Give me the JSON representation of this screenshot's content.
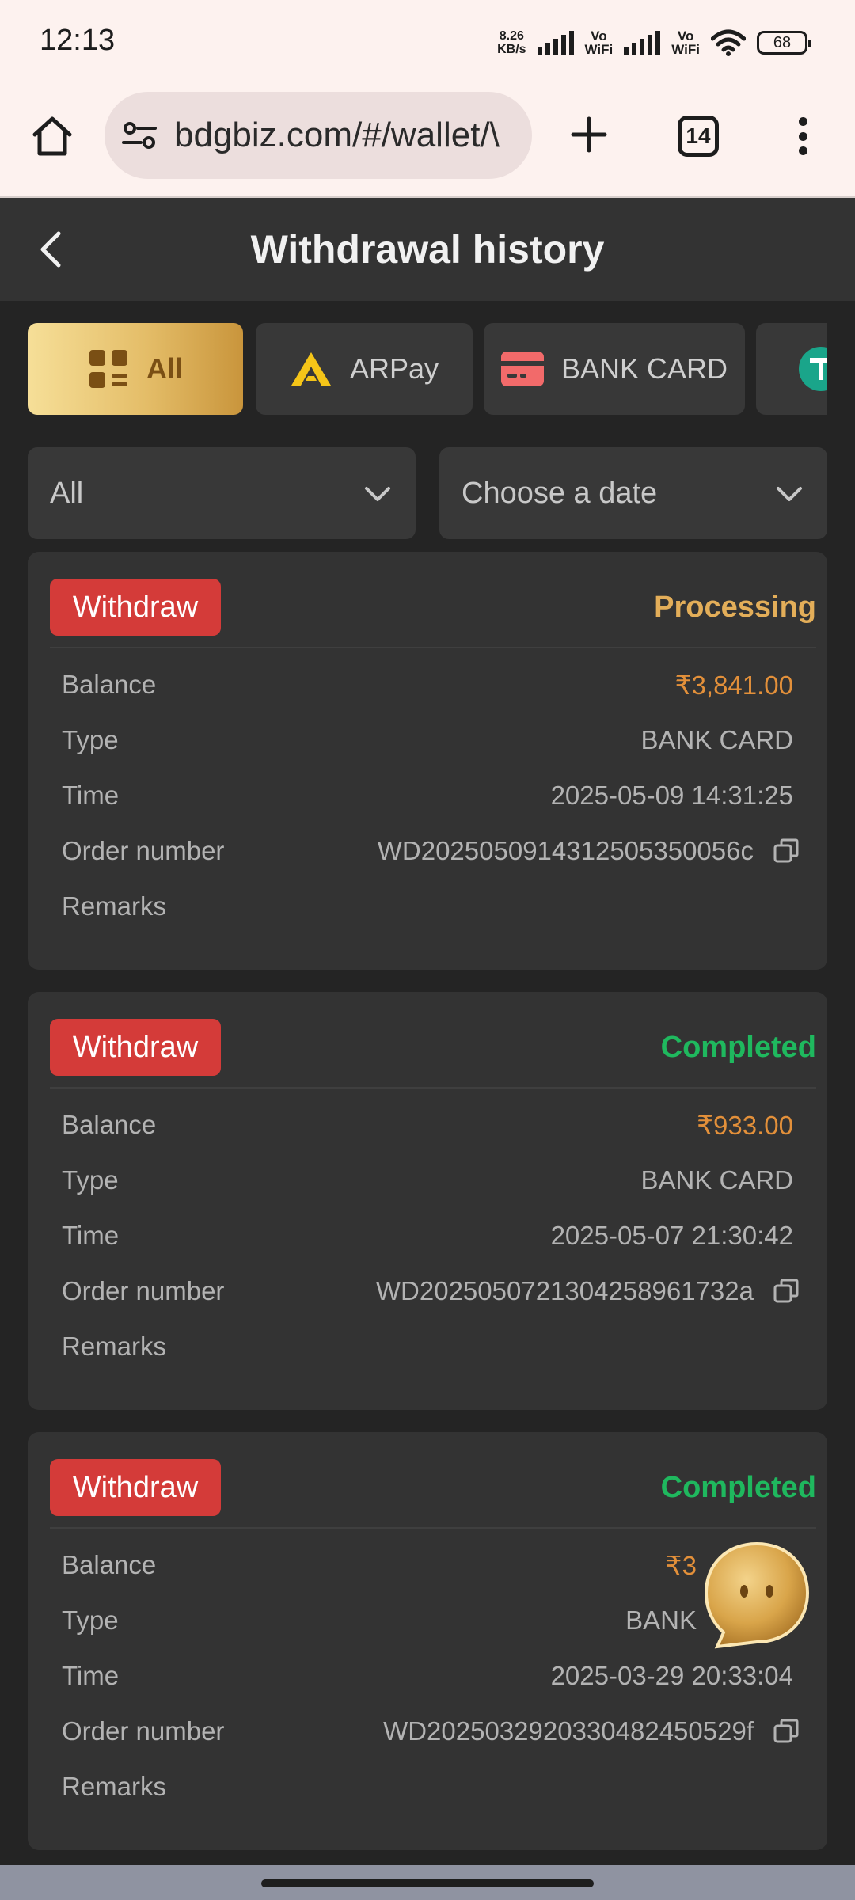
{
  "status_bar": {
    "time": "12:13",
    "net_speed_value": "8.26",
    "net_speed_unit": "KB/s",
    "vowifi_1_top": "Vo",
    "vowifi_1_bottom": "WiFi",
    "vowifi_2_top": "Vo",
    "vowifi_2_bottom": "WiFi",
    "battery": "68"
  },
  "browser": {
    "url": "bdgbiz.com/#/wallet/\\",
    "tab_count": "14"
  },
  "header": {
    "title": "Withdrawal history"
  },
  "tabs": [
    {
      "label": "All",
      "icon": "grid-list-icon",
      "active": true
    },
    {
      "label": "ARPay",
      "icon": "arpay-logo-icon",
      "active": false
    },
    {
      "label": "BANK CARD",
      "icon": "bank-card-icon",
      "active": false
    },
    {
      "label": "",
      "icon": "tether-icon",
      "active": false
    }
  ],
  "filters": {
    "status_value": "All",
    "date_placeholder": "Choose a date"
  },
  "labels": {
    "balance": "Balance",
    "type": "Type",
    "time": "Time",
    "order_number": "Order number",
    "remarks": "Remarks"
  },
  "records": [
    {
      "badge": "Withdraw",
      "status": "Processing",
      "balance": "₹3,841.00",
      "type": "BANK CARD",
      "time": "2025-05-09 14:31:25",
      "order_number": "WD2025050914312505350056c",
      "remarks": ""
    },
    {
      "badge": "Withdraw",
      "status": "Completed",
      "balance": "₹933.00",
      "type": "BANK CARD",
      "time": "2025-05-07 21:30:42",
      "order_number": "WD2025050721304258961732a",
      "remarks": ""
    },
    {
      "badge": "Withdraw",
      "status": "Completed",
      "balance": "₹3",
      "type": "BANK",
      "time": "2025-03-29 20:33:04",
      "order_number": "WD2025032920330482450529f",
      "remarks": ""
    }
  ],
  "colors": {
    "processing": "#e3ae59",
    "completed": "#1fb85e",
    "amount": "#e3903a",
    "badge": "#d43b39",
    "gold_start": "#f6df98",
    "gold_end": "#c9953c"
  }
}
